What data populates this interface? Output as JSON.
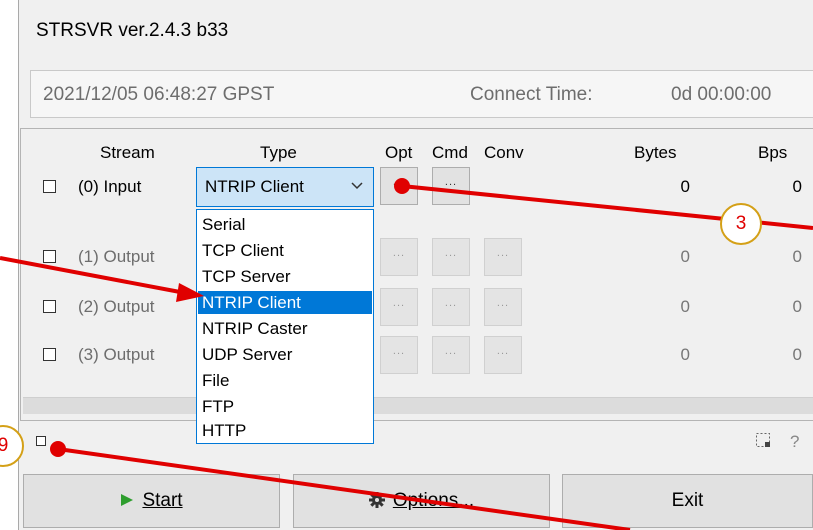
{
  "window": {
    "title": "STRSVR ver.2.4.3 b33"
  },
  "info": {
    "datetime": "2021/12/05 06:48:27 GPST",
    "connect_time_label": "Connect Time:",
    "connect_time_value": "0d 00:00:00"
  },
  "columns": {
    "stream": "Stream",
    "type": "Type",
    "opt": "Opt",
    "cmd": "Cmd",
    "conv": "Conv",
    "bytes": "Bytes",
    "bps": "Bps"
  },
  "rows": [
    {
      "label": "(0) Input",
      "bytes": "0",
      "bps": "0",
      "opt": "...",
      "cmd": "..."
    },
    {
      "label": "(1) Output",
      "bytes": "0",
      "bps": "0",
      "opt": "...",
      "cmd": "...",
      "conv": "..."
    },
    {
      "label": "(2) Output",
      "bytes": "0",
      "bps": "0",
      "opt": "...",
      "cmd": "...",
      "conv": "..."
    },
    {
      "label": "(3) Output",
      "bytes": "0",
      "bps": "0",
      "opt": "...",
      "cmd": "...",
      "conv": "..."
    }
  ],
  "type_select": {
    "value": "NTRIP Client",
    "options": [
      "Serial",
      "TCP Client",
      "TCP Server",
      "NTRIP Client",
      "NTRIP Caster",
      "UDP Server",
      "File",
      "FTP",
      "HTTP"
    ],
    "highlighted_index": 3
  },
  "status": {
    "help_glyph": "?"
  },
  "buttons": {
    "start_label": "Start",
    "options_label": "Options...",
    "exit_label": "Exit"
  },
  "annotations": {
    "callout_3": "3",
    "callout_9": "9",
    "arrow_color": "#e00000",
    "callout_border": "#d4a017"
  },
  "colors": {
    "selection": "#0078d7",
    "combo_bg": "#cce4f7",
    "start_arrow": "#2e9e2e"
  }
}
